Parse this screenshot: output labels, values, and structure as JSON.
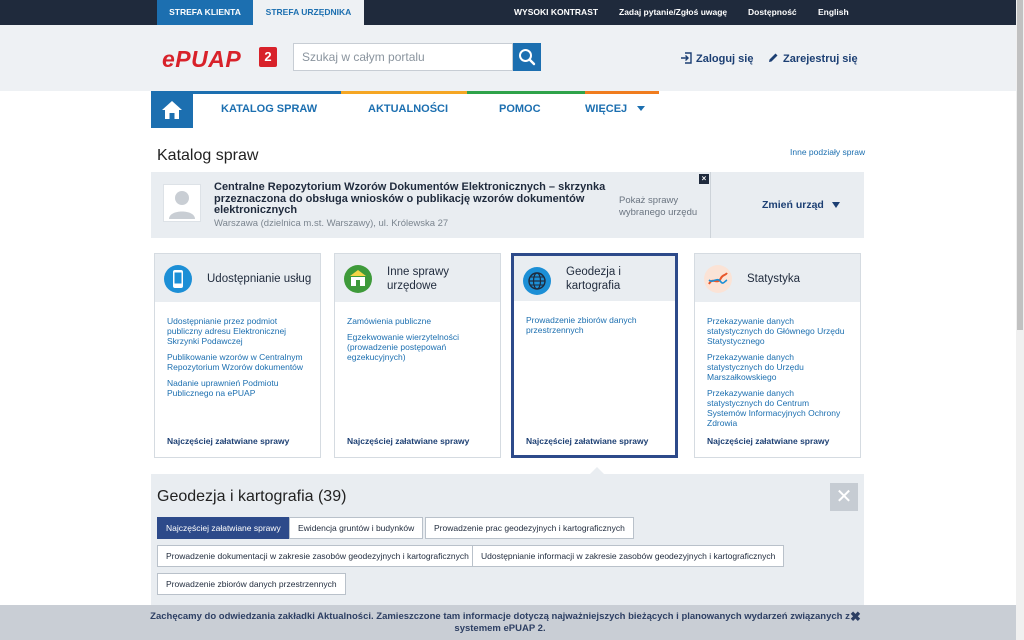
{
  "topbar": {
    "zone_client": "STREFA KLIENTA",
    "zone_official": "STREFA URZĘDNIKA",
    "high_contrast": "WYSOKI KONTRAST",
    "ask": "Zadaj pytanie/Zgłoś uwagę",
    "accessibility": "Dostępność",
    "language": "English"
  },
  "header": {
    "logo_text": "ePUAP",
    "logo_badge": "2",
    "search_placeholder": "Szukaj w całym portalu",
    "login": "Zaloguj się",
    "register": "Zarejestruj się"
  },
  "nav": {
    "items": [
      "KATALOG SPRAW",
      "AKTUALNOŚCI",
      "POMOC",
      "WIĘCEJ"
    ],
    "bar_colors": [
      "#1c6fb0",
      "#f5a623",
      "#2fa34a",
      "#d8222a",
      "#f07c1e"
    ]
  },
  "page": {
    "title": "Katalog spraw",
    "other_divisions": "Inne podziały spraw"
  },
  "office": {
    "name": "Centralne Repozytorium Wzorów Dokumentów Elektronicznych – skrzynka przeznaczona do obsługa wniosków o publikację wzorów dokumentów elektronicznych",
    "address": "Warszawa (dzielnica m.st. Warszawy), ul. Królewska 27",
    "show_cases": "Pokaż sprawy wybranego urzędu",
    "change": "Zmień urząd",
    "close": "×"
  },
  "cards": [
    {
      "title": "Udostępnianie usług",
      "links": [
        "Udostępnianie przez podmiot publiczny adresu Elektronicznej Skrzynki Podawczej",
        "Publikowanie wzorów w Centralnym Repozytorium Wzorów dokumentów",
        "Nadanie uprawnień Podmiotu Publicznego na ePUAP"
      ],
      "footer": "Najczęściej załatwiane sprawy"
    },
    {
      "title": "Inne sprawy urzędowe",
      "links": [
        "Zamówienia publiczne",
        "Egzekwowanie wierzytelności (prowadzenie postępowań egzekucyjnych)"
      ],
      "footer": "Najczęściej załatwiane sprawy"
    },
    {
      "title": "Geodezja i kartografia",
      "links": [
        "Prowadzenie zbiorów danych przestrzennych"
      ],
      "footer": "Najczęściej załatwiane sprawy"
    },
    {
      "title": "Statystyka",
      "links": [
        "Przekazywanie danych statystycznych do Głównego Urzędu Statystycznego",
        "Przekazywanie danych statystycznych do Urzędu Marszałkowskiego",
        "Przekazywanie danych statystycznych do Centrum Systemów Informacyjnych Ochrony Zdrowia"
      ],
      "footer": "Najczęściej załatwiane sprawy"
    }
  ],
  "section": {
    "title": "Geodezja i kartografia (39)",
    "chips": [
      "Najczęściej załatwiane sprawy",
      "Ewidencja gruntów i budynków",
      "Prowadzenie prac geodezyjnych i kartograficznych",
      "Prowadzenie dokumentacji w zakresie zasobów geodezyjnych i kartograficznych",
      "Udostępnianie informacji w zakresie zasobów geodezyjnych i kartograficznych",
      "Prowadzenie zbiorów danych przestrzennych"
    ]
  },
  "notice": {
    "text": "Zachęcamy do odwiedzania zakładki Aktualności. Zamieszczone tam informacje dotyczą najważniejszych bieżących i planowanych wydarzeń związanych z systemem ePUAP 2.",
    "close": "✖"
  }
}
